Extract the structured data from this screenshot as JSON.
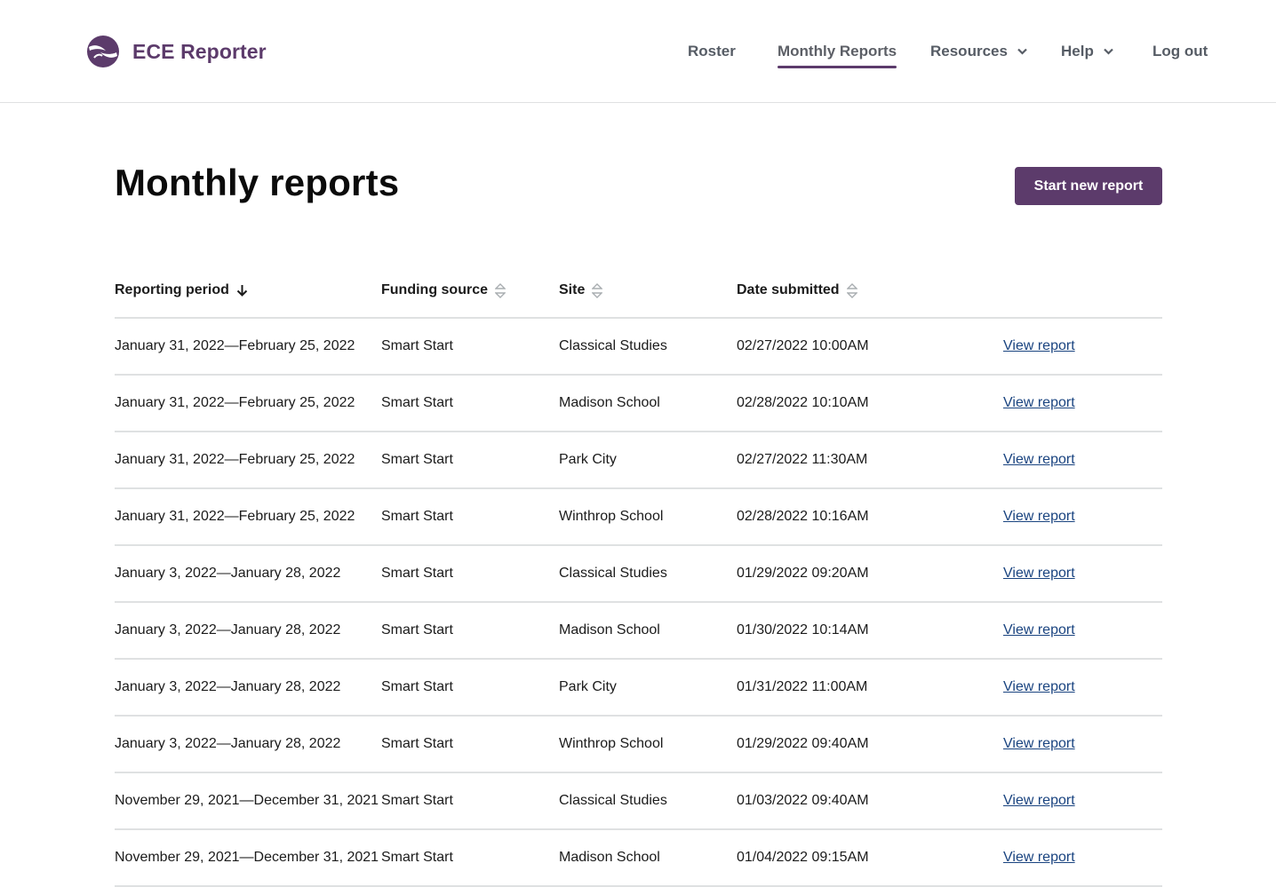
{
  "brand": {
    "name": "ECE Reporter",
    "logo_icon": "hands-icon",
    "color": "#5c3b6b"
  },
  "nav": {
    "items": [
      {
        "label": "Roster",
        "active": false,
        "dropdown": false
      },
      {
        "label": "Monthly Reports",
        "active": true,
        "dropdown": false
      },
      {
        "label": "Resources",
        "active": false,
        "dropdown": true
      },
      {
        "label": "Help",
        "active": false,
        "dropdown": true
      },
      {
        "label": "Log out",
        "active": false,
        "dropdown": false
      }
    ]
  },
  "page": {
    "title": "Monthly reports",
    "primary_button": "Start new report"
  },
  "table": {
    "columns": [
      {
        "label": "Reporting period",
        "sort": "descending"
      },
      {
        "label": "Funding source",
        "sort": "none"
      },
      {
        "label": "Site",
        "sort": "none"
      },
      {
        "label": "Date submitted",
        "sort": "none"
      }
    ],
    "rows": [
      {
        "period": "January 31, 2022—February 25, 2022",
        "funding": "Smart Start",
        "site": "Classical Studies",
        "submitted": "02/27/2022 10:00AM",
        "action": "View report"
      },
      {
        "period": "January 31, 2022—February 25, 2022",
        "funding": "Smart Start",
        "site": "Madison School",
        "submitted": "02/28/2022 10:10AM",
        "action": "View report"
      },
      {
        "period": "January 31, 2022—February 25, 2022",
        "funding": "Smart Start",
        "site": "Park City",
        "submitted": "02/27/2022 11:30AM",
        "action": "View report"
      },
      {
        "period": "January 31, 2022—February 25, 2022",
        "funding": "Smart Start",
        "site": "Winthrop School",
        "submitted": "02/28/2022 10:16AM",
        "action": "View report"
      },
      {
        "period": "January 3, 2022—January 28, 2022",
        "funding": "Smart Start",
        "site": "Classical Studies",
        "submitted": "01/29/2022 09:20AM",
        "action": "View report"
      },
      {
        "period": "January 3, 2022—January 28, 2022",
        "funding": "Smart Start",
        "site": "Madison School",
        "submitted": "01/30/2022 10:14AM",
        "action": "View report"
      },
      {
        "period": "January 3, 2022—January 28, 2022",
        "funding": "Smart Start",
        "site": "Park City",
        "submitted": "01/31/2022 11:00AM",
        "action": "View report"
      },
      {
        "period": "January 3, 2022—January 28, 2022",
        "funding": "Smart Start",
        "site": "Winthrop School",
        "submitted": "01/29/2022 09:40AM",
        "action": "View report"
      },
      {
        "period": "November 29, 2021—December 31, 2021",
        "funding": "Smart Start",
        "site": "Classical Studies",
        "submitted": "01/03/2022 09:40AM",
        "action": "View report"
      },
      {
        "period": "November 29, 2021—December 31, 2021",
        "funding": "Smart Start",
        "site": "Madison School",
        "submitted": "01/04/2022 09:15AM",
        "action": "View report"
      }
    ]
  }
}
